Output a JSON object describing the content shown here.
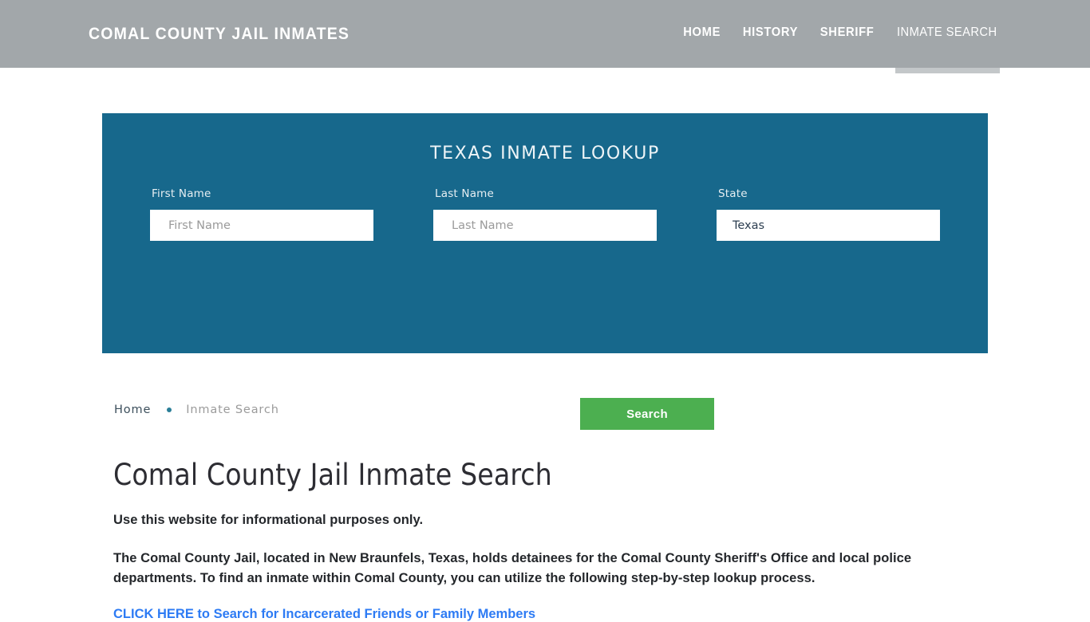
{
  "header": {
    "brand": "COMAL COUNTY JAIL INMATES",
    "nav": [
      {
        "label": "HOME",
        "active": false
      },
      {
        "label": "HISTORY",
        "active": false
      },
      {
        "label": "SHERIFF",
        "active": false
      },
      {
        "label": "INMATE SEARCH",
        "active": true
      }
    ]
  },
  "search_panel": {
    "title": "TEXAS INMATE LOOKUP",
    "first_name": {
      "label": "First Name",
      "placeholder": "First Name",
      "value": ""
    },
    "last_name": {
      "label": "Last Name",
      "placeholder": "Last Name",
      "value": ""
    },
    "state": {
      "label": "State",
      "selected": "Texas"
    },
    "submit_label": "Search",
    "panel_color": "#17688c",
    "button_color": "#4caf50"
  },
  "breadcrumb": {
    "home": "Home",
    "separator": "•",
    "current": "Inmate Search"
  },
  "main": {
    "title": "Comal County Jail Inmate Search",
    "paragraph_1": "Use this website for informational purposes only.",
    "paragraph_2": "The Comal County Jail, located in New Braunfels, Texas, holds detainees for the Comal County Sheriff's Office and local police departments. To find an inmate within Comal County, you can utilize the following step-by-step lookup process.",
    "cta_link": "CLICK HERE to Search for Incarcerated Friends or Family Members",
    "link_color": "#2d7bf4"
  }
}
